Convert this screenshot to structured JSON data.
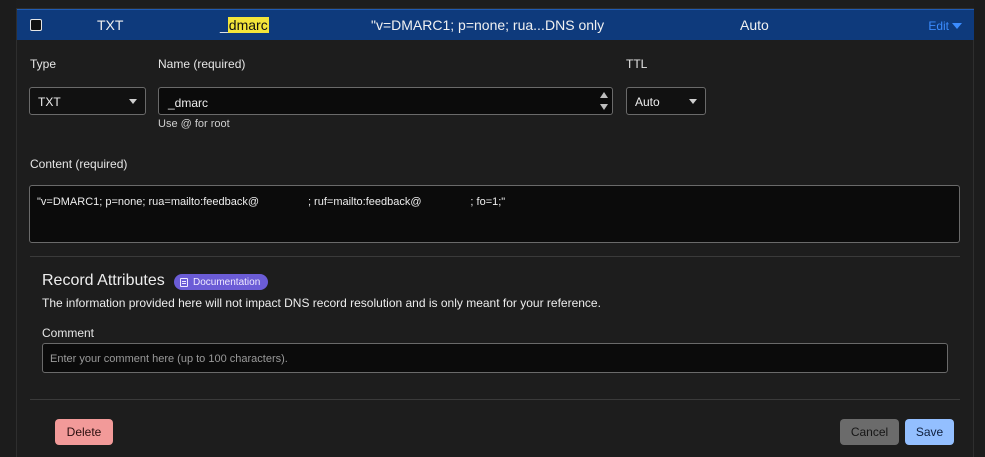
{
  "record": {
    "type": "TXT",
    "name_prefix": "_",
    "name_highlight": "dmarc",
    "content_preview": "\"v=DMARC1; p=none; rua...",
    "proxy_status": "DNS only",
    "ttl": "Auto",
    "edit_label": "Edit"
  },
  "form": {
    "type_label": "Type",
    "type_value": "TXT",
    "name_label": "Name (required)",
    "name_value": "_dmarc",
    "name_hint": "Use @ for root",
    "ttl_label": "TTL",
    "ttl_value": "Auto",
    "content_label": "Content (required)",
    "content_value": "\"v=DMARC1; p=none; rua=mailto:feedback@                ; ruf=mailto:feedback@                ; fo=1;\""
  },
  "attributes": {
    "title": "Record Attributes",
    "doc_badge": "Documentation",
    "description": "The information provided here will not impact DNS record resolution and is only meant for your reference.",
    "comment_label": "Comment",
    "comment_placeholder": "Enter your comment here (up to 100 characters)."
  },
  "actions": {
    "delete": "Delete",
    "cancel": "Cancel",
    "save": "Save"
  }
}
